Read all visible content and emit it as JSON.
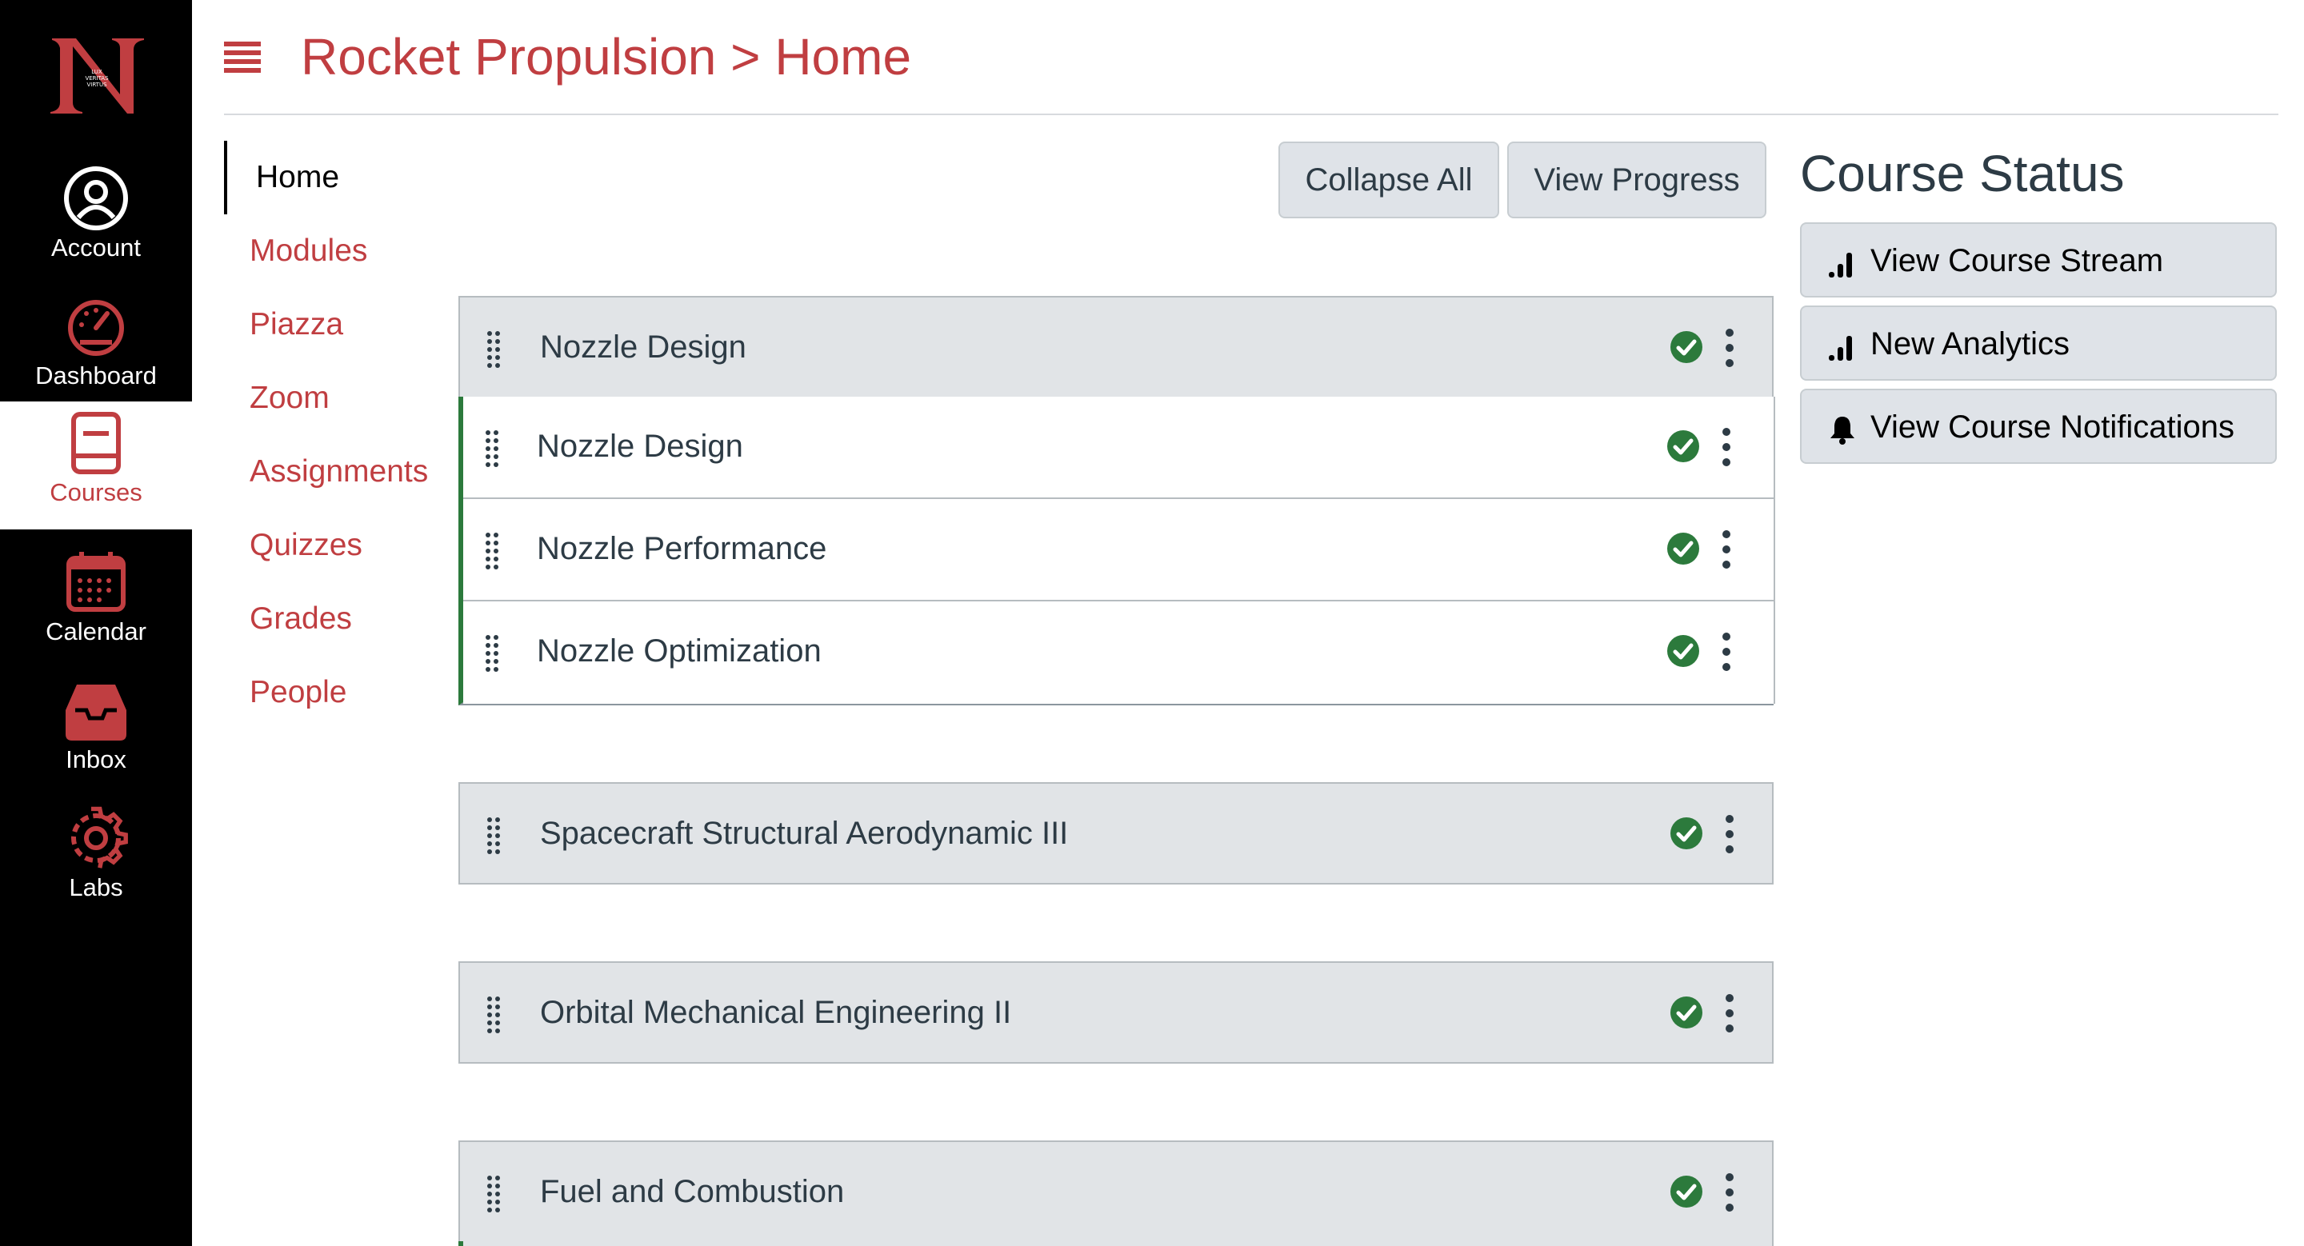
{
  "global_nav": {
    "items": [
      {
        "label": "Account",
        "icon": "account-icon"
      },
      {
        "label": "Dashboard",
        "icon": "dashboard-icon"
      },
      {
        "label": "Courses",
        "icon": "courses-icon",
        "active": true
      },
      {
        "label": "Calendar",
        "icon": "calendar-icon"
      },
      {
        "label": "Inbox",
        "icon": "inbox-icon"
      },
      {
        "label": "Labs",
        "icon": "labs-icon"
      }
    ]
  },
  "header": {
    "breadcrumb": "Rocket Propulsion > Home"
  },
  "course_nav": {
    "items": [
      "Home",
      "Modules",
      "Piazza",
      "Zoom",
      "Assignments",
      "Quizzes",
      "Grades",
      "People"
    ],
    "active": "Home"
  },
  "toolbar": {
    "collapse_label": "Collapse All",
    "progress_label": "View Progress"
  },
  "modules": [
    {
      "title": "Nozzle Design",
      "completed": true,
      "items": [
        {
          "title": "Nozzle Design",
          "completed": true
        },
        {
          "title": "Nozzle Performance",
          "completed": true
        },
        {
          "title": "Nozzle Optimization",
          "completed": true
        }
      ]
    },
    {
      "title": "Spacecraft Structural Aerodynamic III",
      "completed": true
    },
    {
      "title": "Orbital Mechanical Engineering II",
      "completed": true
    },
    {
      "title": "Fuel and Combustion",
      "completed": true
    }
  ],
  "course_status": {
    "title": "Course Status",
    "buttons": [
      {
        "label": "View Course Stream",
        "icon": "bar-chart-icon"
      },
      {
        "label": "New Analytics",
        "icon": "bar-chart-icon"
      },
      {
        "label": "View Course Notifications",
        "icon": "bell-icon"
      }
    ]
  },
  "colors": {
    "brand_red": "#c03e41",
    "nav_bg": "#000000",
    "success_green": "#2c7a3c",
    "module_header_bg": "#e1e4e7"
  }
}
